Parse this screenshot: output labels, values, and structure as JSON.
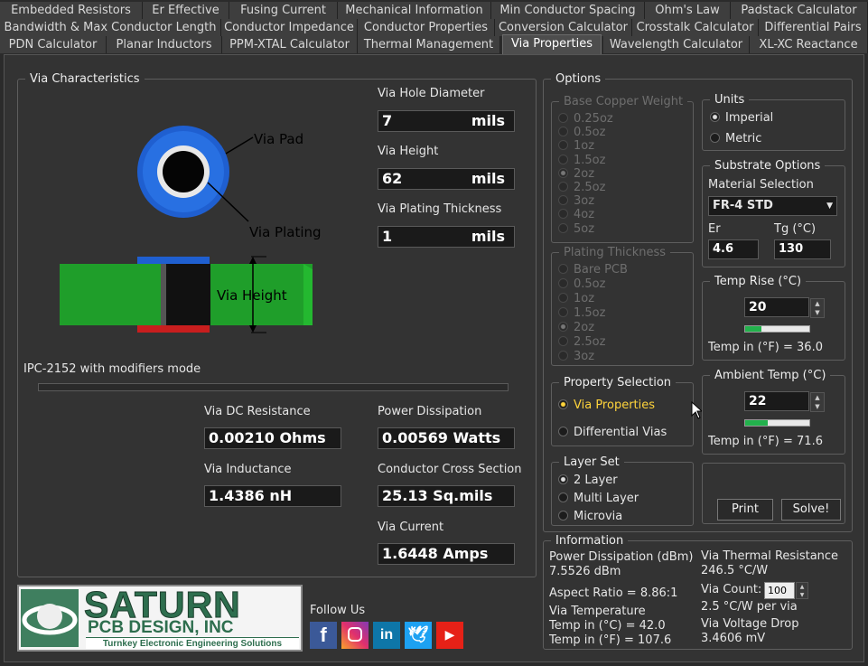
{
  "tabs_row1": [
    "Embedded Resistors",
    "Er Effective",
    "Fusing Current",
    "Mechanical Information",
    "Min Conductor Spacing",
    "Ohm's Law",
    "Padstack Calculator"
  ],
  "tabs_row2": [
    "Bandwidth & Max Conductor Length",
    "Conductor Impedance",
    "Conductor Properties",
    "Conversion Calculator",
    "Crosstalk Calculator",
    "Differential Pairs"
  ],
  "tabs_row3": [
    "PDN Calculator",
    "Planar Inductors",
    "PPM-XTAL Calculator",
    "Thermal Management",
    "Via Properties",
    "Wavelength Calculator",
    "XL-XC Reactance"
  ],
  "active_tab": "Via Properties",
  "via_char": {
    "legend": "Via Characteristics",
    "via_pad_label": "Via Pad",
    "via_plating_label": "Via Plating",
    "via_height_label": "Via Height",
    "hole_diameter_label": "Via Hole Diameter",
    "hole_diameter_value": "7",
    "hole_diameter_unit": "mils",
    "height_label": "Via Height",
    "height_value": "62",
    "height_unit": "mils",
    "plating_label": "Via Plating Thickness",
    "plating_value": "1",
    "plating_unit": "mils",
    "mode_text": "IPC-2152 with modifiers mode",
    "dc_res_label": "Via DC Resistance",
    "dc_res_value": "0.00210 Ohms",
    "power_label": "Power Dissipation",
    "power_value": "0.00569 Watts",
    "inductance_label": "Via Inductance",
    "inductance_value": "1.4386 nH",
    "cross_label": "Conductor Cross Section",
    "cross_value": "25.13 Sq.mils",
    "current_label": "Via Current",
    "current_value": "1.6448 Amps"
  },
  "options": {
    "legend": "Options",
    "base_copper": {
      "legend": "Base Copper Weight",
      "items": [
        "0.25oz",
        "0.5oz",
        "1oz",
        "1.5oz",
        "2oz",
        "2.5oz",
        "3oz",
        "4oz",
        "5oz"
      ],
      "selected": "2oz"
    },
    "plating": {
      "legend": "Plating Thickness",
      "items": [
        "Bare PCB",
        "0.5oz",
        "1oz",
        "1.5oz",
        "2oz",
        "2.5oz",
        "3oz"
      ],
      "selected": "2oz"
    },
    "units": {
      "legend": "Units",
      "items": [
        "Imperial",
        "Metric"
      ],
      "selected": "Imperial"
    },
    "substrate": {
      "legend": "Substrate Options",
      "material_label": "Material Selection",
      "material_value": "FR-4 STD",
      "er_label": "Er",
      "er_value": "4.6",
      "tg_label": "Tg (°C)",
      "tg_value": "130"
    },
    "temp_rise": {
      "legend": "Temp Rise (°C)",
      "value": "20",
      "fill": 0.25,
      "readout": "Temp in (°F) = 36.0"
    },
    "ambient": {
      "legend": "Ambient Temp (°C)",
      "value": "22",
      "fill": 0.35,
      "readout": "Temp in (°F) = 71.6"
    },
    "property": {
      "legend": "Property Selection",
      "items": [
        "Via Properties",
        "Differential Vias"
      ],
      "selected": "Via Properties"
    },
    "layer_set": {
      "legend": "Layer Set",
      "items": [
        "2 Layer",
        "Multi Layer",
        "Microvia"
      ],
      "selected": "2 Layer"
    },
    "print_label": "Print",
    "solve_label": "Solve!"
  },
  "info": {
    "legend": "Information",
    "power_dbm_label": "Power Dissipation (dBm)",
    "power_dbm_value": "7.5526 dBm",
    "aspect_ratio": "Aspect Ratio =  8.86:1",
    "via_temp_label": "Via Temperature",
    "temp_c": "Temp in (°C) = 42.0",
    "temp_f": "Temp in (°F) = 107.6",
    "thermal_res_label": "Via Thermal Resistance",
    "thermal_res_value": "246.5 °C/W",
    "via_count_label": "Via Count:",
    "via_count_value": "100",
    "per_via": "2.5 °C/W per via",
    "voltage_drop_label": "Via Voltage Drop",
    "voltage_drop_value": "3.4606 mV"
  },
  "footer": {
    "logo_main": "SATURN",
    "logo_sub": "PCB DESIGN, INC",
    "logo_tag": "Turnkey Electronic Engineering Solutions",
    "follow_us": "Follow Us",
    "social": [
      "facebook-icon",
      "instagram-icon",
      "linkedin-icon",
      "twitter-icon",
      "youtube-icon"
    ]
  },
  "colors": {
    "green": "#1f9e2a",
    "accent_yellow": "#ffd43b",
    "pad_blue": "#1f5fd0"
  }
}
